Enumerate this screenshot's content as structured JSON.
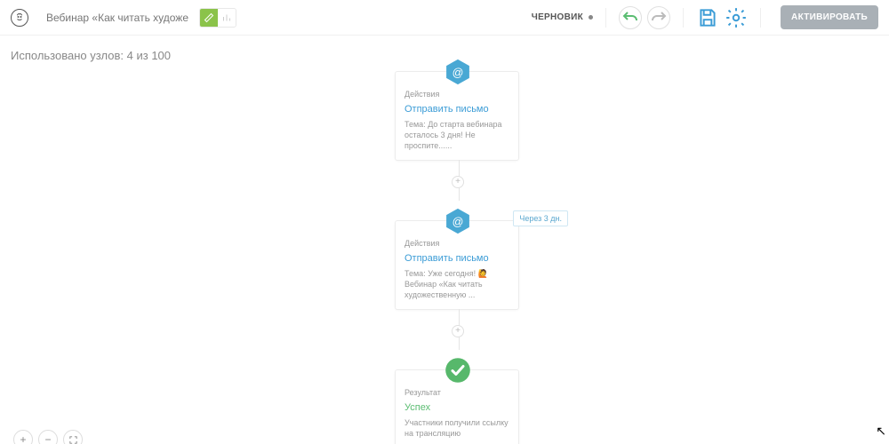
{
  "header": {
    "title": "Вебинар «Как читать художес",
    "status": "ЧЕРНОВИК",
    "activate": "АКТИВИРОВАТЬ"
  },
  "usage": "Использовано узлов: 4 из 100",
  "cards": {
    "c1": {
      "label": "Действия",
      "title": "Отправить письмо",
      "desc": "Тема: До старта вебинара осталось 3 дня! Не проспите......"
    },
    "c2": {
      "label": "Действия",
      "title": "Отправить письмо",
      "desc": "Тема: Уже сегодня! 🙋 Вебинар «Как читать художественную ...",
      "badge": "Через 3 дн."
    },
    "c3": {
      "label": "Результат",
      "title": "Успех",
      "desc": "Участники получили ссылку на трансляцию"
    }
  }
}
